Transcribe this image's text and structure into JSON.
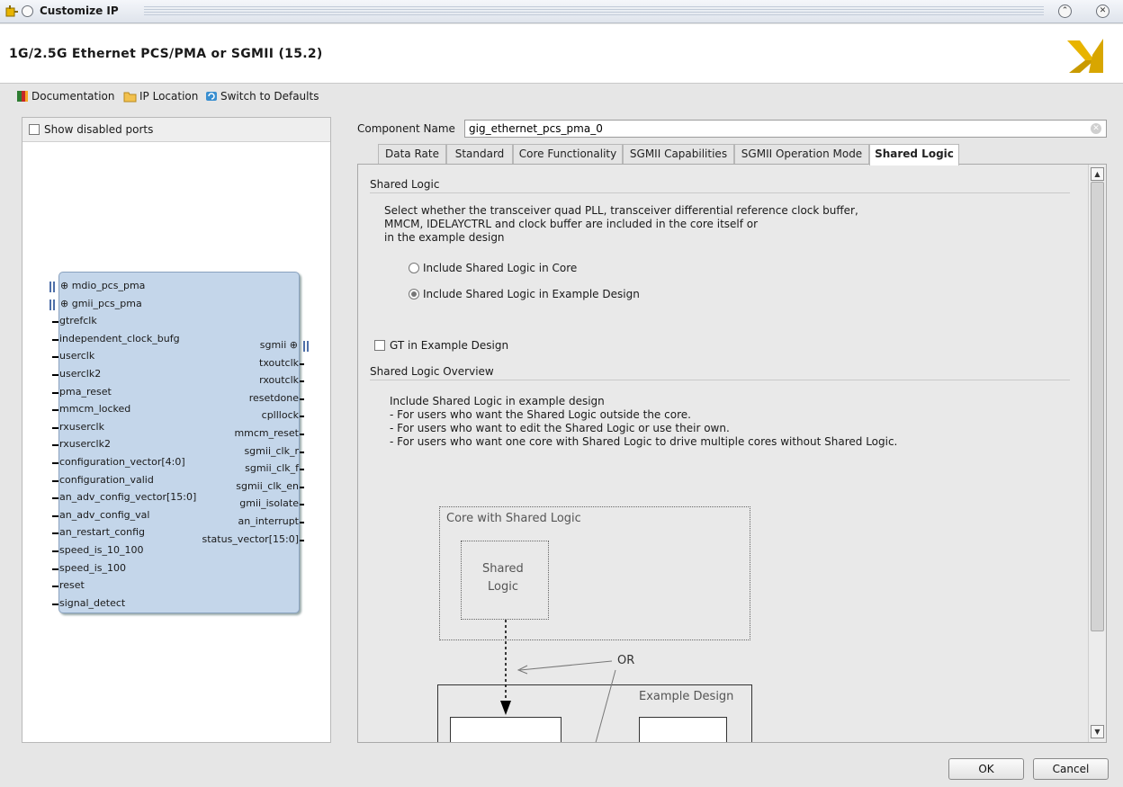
{
  "window": {
    "title": "Customize IP",
    "icon": "ip-customize-icon",
    "buttons": [
      "minimize-icon",
      "close-icon"
    ]
  },
  "header": {
    "title": "1G/2.5G Ethernet PCS/PMA or SGMII (15.2)"
  },
  "toolbar": {
    "documentation": "Documentation",
    "ip_location": "IP Location",
    "switch_defaults": "Switch to Defaults"
  },
  "left_panel": {
    "show_disabled_ports": "Show disabled ports",
    "left_ports": [
      {
        "name": "mdio_pcs_pma",
        "type": "bus"
      },
      {
        "name": "gmii_pcs_pma",
        "type": "bus"
      },
      {
        "name": "gtrefclk",
        "type": "pin"
      },
      {
        "name": "independent_clock_bufg",
        "type": "pin"
      },
      {
        "name": "userclk",
        "type": "pin"
      },
      {
        "name": "userclk2",
        "type": "pin"
      },
      {
        "name": "pma_reset",
        "type": "pin"
      },
      {
        "name": "mmcm_locked",
        "type": "pin"
      },
      {
        "name": "rxuserclk",
        "type": "pin"
      },
      {
        "name": "rxuserclk2",
        "type": "pin"
      },
      {
        "name": "configuration_vector[4:0]",
        "type": "pin"
      },
      {
        "name": "configuration_valid",
        "type": "pin"
      },
      {
        "name": "an_adv_config_vector[15:0]",
        "type": "pin"
      },
      {
        "name": "an_adv_config_val",
        "type": "pin"
      },
      {
        "name": "an_restart_config",
        "type": "pin"
      },
      {
        "name": "speed_is_10_100",
        "type": "pin"
      },
      {
        "name": "speed_is_100",
        "type": "pin"
      },
      {
        "name": "reset",
        "type": "pin"
      },
      {
        "name": "signal_detect",
        "type": "pin"
      }
    ],
    "right_ports": [
      {
        "name": "sgmii",
        "type": "bus"
      },
      {
        "name": "txoutclk",
        "type": "pin"
      },
      {
        "name": "rxoutclk",
        "type": "pin"
      },
      {
        "name": "resetdone",
        "type": "pin"
      },
      {
        "name": "cplllock",
        "type": "pin"
      },
      {
        "name": "mmcm_reset",
        "type": "pin"
      },
      {
        "name": "sgmii_clk_r",
        "type": "pin"
      },
      {
        "name": "sgmii_clk_f",
        "type": "pin"
      },
      {
        "name": "sgmii_clk_en",
        "type": "pin"
      },
      {
        "name": "gmii_isolate",
        "type": "pin"
      },
      {
        "name": "an_interrupt",
        "type": "pin"
      },
      {
        "name": "status_vector[15:0]",
        "type": "pin"
      }
    ]
  },
  "component": {
    "label": "Component Name",
    "value": "gig_ethernet_pcs_pma_0"
  },
  "tabs": [
    {
      "label": "Data Rate",
      "active": false
    },
    {
      "label": "Standard",
      "active": false
    },
    {
      "label": "Core Functionality",
      "active": false
    },
    {
      "label": "SGMII Capabilities",
      "active": false
    },
    {
      "label": "SGMII Operation Mode",
      "active": false
    },
    {
      "label": "Shared Logic",
      "active": true
    }
  ],
  "shared_logic": {
    "title": "Shared Logic",
    "description": [
      "Select whether the transceiver quad PLL, transceiver differential reference clock buffer,",
      "MMCM, IDELAYCTRL and clock buffer are included in the core itself or",
      "in the example design"
    ],
    "options": [
      {
        "label": "Include Shared Logic in Core",
        "selected": false
      },
      {
        "label": "Include Shared Logic in Example Design",
        "selected": true
      }
    ],
    "gt_checkbox": {
      "label": "GT in Example Design",
      "checked": false
    }
  },
  "overview": {
    "title": "Shared Logic Overview",
    "lines": [
      "Include Shared Logic in example design",
      "- For users who want the Shared Logic outside the core.",
      "- For users who want to edit the Shared Logic or use their own.",
      "- For users who want one core with Shared Logic to drive multiple cores without Shared Logic."
    ],
    "diagram": {
      "core_box": "Core with Shared Logic",
      "shared_logic_line1": "Shared",
      "shared_logic_line2": "Logic",
      "or_label": "OR",
      "example_design": "Example Design"
    }
  },
  "buttons": {
    "ok": "OK",
    "cancel": "Cancel"
  },
  "colors": {
    "ip_block_fill": "#c4d6ea",
    "bus_marker": "#4e6fa8",
    "logo_yellow": "#e8b400"
  }
}
